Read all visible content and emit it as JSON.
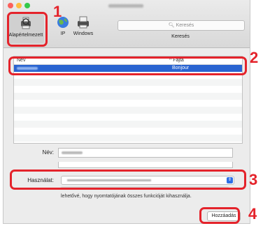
{
  "toolbar": {
    "tools": [
      {
        "label": "Alapértelmezett",
        "icon": "printer-icon"
      },
      {
        "label": "IP",
        "icon": "globe-icon"
      },
      {
        "label": "Windows",
        "icon": "windows-printer-icon"
      }
    ],
    "search_placeholder": "Keresés",
    "search_caption": "Keresés"
  },
  "list": {
    "headers": {
      "name": "Név",
      "kind": "Fajta"
    },
    "rows": [
      {
        "name": "",
        "kind": "Bonjour"
      }
    ]
  },
  "form": {
    "name_label": "Név:",
    "use_label": "Használat:",
    "info_text": "lehetővé, hogy nyomtatójának összes funkcióját kihasználja."
  },
  "actions": {
    "add_label": "Hozzáadás"
  },
  "callouts": [
    "1",
    "2",
    "3",
    "4"
  ],
  "colors": {
    "callout": "#e4232b",
    "selection": "#2a64d1",
    "select_accent": "#2d6fe6"
  }
}
